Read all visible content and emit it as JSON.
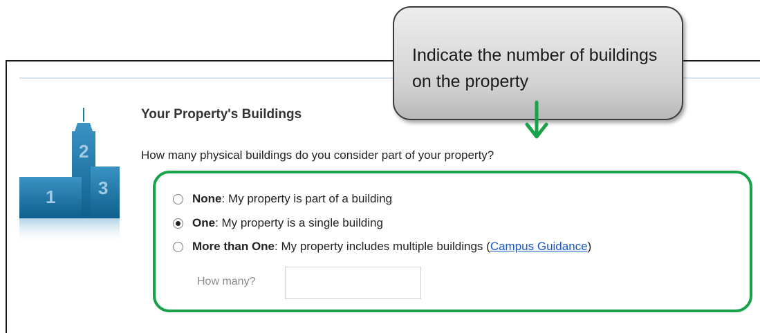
{
  "callout": {
    "text": "Indicate the number of buildings on the property"
  },
  "section": {
    "title": "Your Property's Buildings",
    "question": "How many physical buildings do you consider part of your property?"
  },
  "illustration": {
    "labels": [
      "1",
      "2",
      "3"
    ],
    "color": "#1f78a8"
  },
  "options": [
    {
      "name": "None",
      "desc": ": My property is part of a building",
      "checked": false
    },
    {
      "name": "One",
      "desc": ": My property is a single building",
      "checked": true
    },
    {
      "name": "More than One",
      "desc": ": My property includes multiple buildings (",
      "link": "Campus Guidance",
      "tail": ")",
      "checked": false
    }
  ],
  "how_many": {
    "label": "How many?",
    "value": ""
  },
  "colors": {
    "highlight": "#1aa24a",
    "link": "#1a57c4",
    "arrow": "#1aa24a"
  }
}
